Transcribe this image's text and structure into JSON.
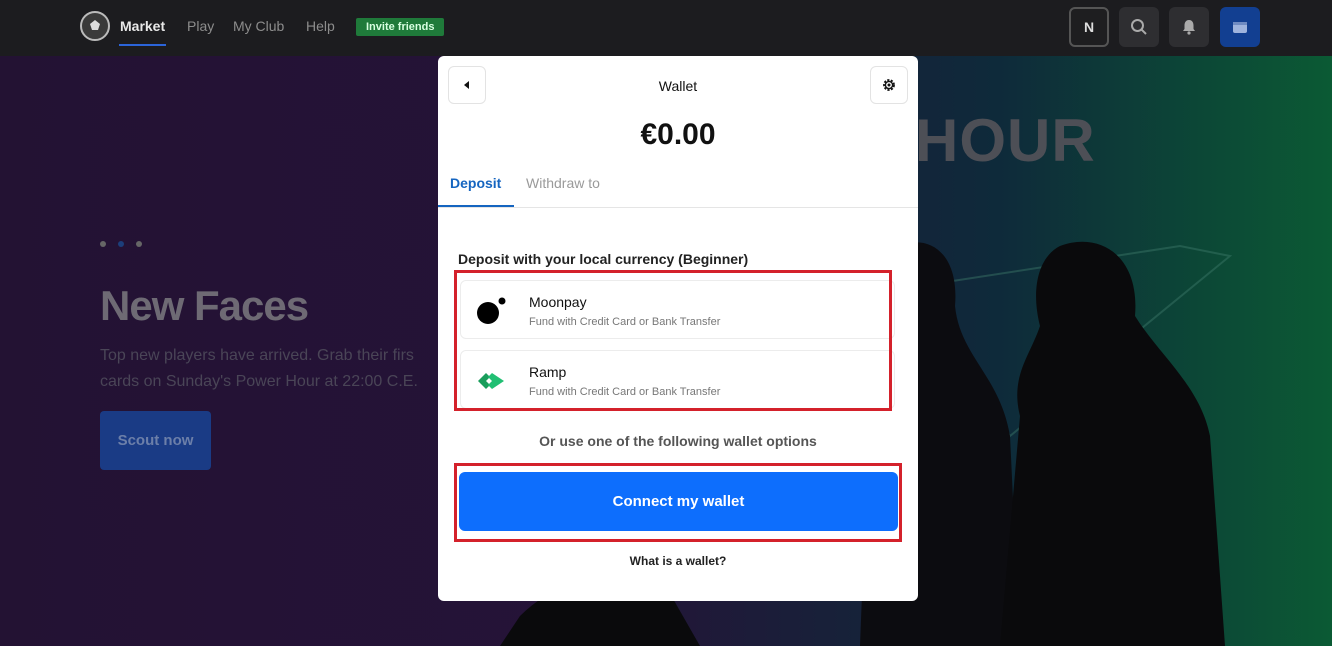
{
  "topbar": {
    "nav": [
      "Market",
      "Play",
      "My Club",
      "Help"
    ],
    "invite_label": "Invite friends",
    "profile_initial": "N"
  },
  "hero": {
    "title": "New Faces",
    "subtitle_line1": "Top new players have arrived. Grab their firs",
    "subtitle_line2": "cards on Sunday's Power Hour at 22:00 C.E.",
    "cta": "Scout now",
    "banner_text": "HOUR",
    "slide_count": 3,
    "active_slide": 2
  },
  "wallet": {
    "title": "Wallet",
    "balance": "€0.00",
    "tabs": [
      "Deposit",
      "Withdraw to"
    ],
    "active_tab": "Deposit",
    "section_label": "Deposit with your local currency (Beginner)",
    "providers": [
      {
        "name": "Moonpay",
        "description": "Fund with Credit Card or Bank Transfer",
        "icon": "moonpay-icon"
      },
      {
        "name": "Ramp",
        "description": "Fund with Credit Card or Bank Transfer",
        "icon": "ramp-icon"
      }
    ],
    "alt_options_text": "Or use one of the following wallet options",
    "connect_label": "Connect my wallet",
    "help_link": "What is a wallet?"
  },
  "colors": {
    "accent": "#0d6efd",
    "tab_active": "#1565c0",
    "highlight": "#d4212b",
    "invite_bg": "#1f7a3a",
    "ramp_green": "#21bf73"
  }
}
